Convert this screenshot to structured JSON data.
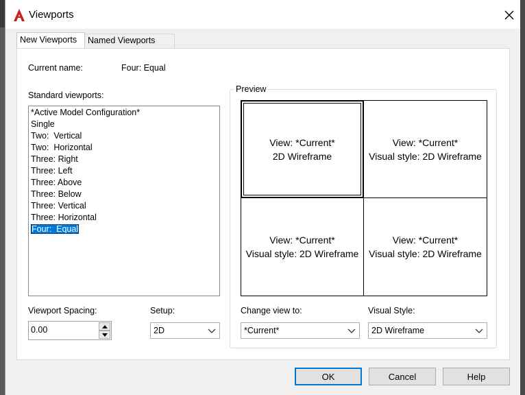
{
  "window": {
    "title": "Viewports",
    "close_symbol": "✕",
    "icon": "autocad-icon"
  },
  "tabs": [
    {
      "label": "New Viewports",
      "active": true
    },
    {
      "label": "Named Viewports",
      "active": false
    }
  ],
  "current_name": {
    "label": "Current name:",
    "value": "Four:  Equal"
  },
  "standard": {
    "label": "Standard viewports:",
    "items": [
      "*Active Model Configuration*",
      "Single",
      "Two:  Vertical",
      "Two:  Horizontal",
      "Three: Right",
      "Three: Left",
      "Three: Above",
      "Three: Below",
      "Three: Vertical",
      "Three: Horizontal",
      "Four:  Equal"
    ],
    "selected_index": 10
  },
  "preview": {
    "label": "Preview",
    "viewports": [
      {
        "line1": "View: *Current*",
        "line2": "2D Wireframe",
        "current": true
      },
      {
        "line1": "View: *Current*",
        "line2": "Visual style: 2D Wireframe",
        "current": false
      },
      {
        "line1": "View: *Current*",
        "line2": "Visual style: 2D Wireframe",
        "current": false
      },
      {
        "line1": "View: *Current*",
        "line2": "Visual style: 2D Wireframe",
        "current": false
      }
    ]
  },
  "spacing": {
    "label": "Viewport Spacing:",
    "value": "0.00"
  },
  "setup": {
    "label": "Setup:",
    "value": "2D"
  },
  "change_view": {
    "label": "Change view to:",
    "value": "*Current*"
  },
  "visual_style": {
    "label": "Visual Style:",
    "value": "2D Wireframe"
  },
  "buttons": {
    "ok": "OK",
    "cancel": "Cancel",
    "help": "Help"
  },
  "colors": {
    "selection": "#0078d7",
    "default_button_border": "#0078d7",
    "app_icon": "#c8201e"
  }
}
